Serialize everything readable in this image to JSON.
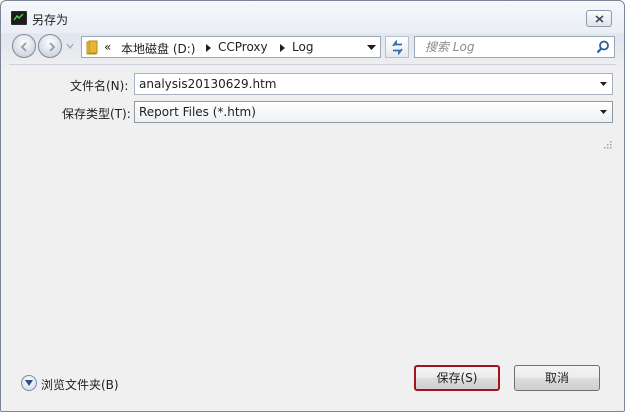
{
  "window": {
    "title": "另存为"
  },
  "address": {
    "overflow": "«",
    "crumbs": [
      "本地磁盘 (D:)",
      "CCProxy",
      "Log"
    ]
  },
  "search": {
    "placeholder": "搜索 Log"
  },
  "form": {
    "filename_label": "文件名(N):",
    "filename_value": "analysis20130629.htm",
    "filetype_label": "保存类型(T):",
    "filetype_value": "Report Files (*.htm)"
  },
  "footer": {
    "browse_label": "浏览文件夹(B)",
    "save_label": "保存(S)",
    "cancel_label": "取消"
  },
  "colors": {
    "save_border": "#a3131c",
    "window_border": "#7a8696",
    "folder": "#e8b632"
  },
  "icons": {
    "app": "terminal-icon",
    "close": "close-icon",
    "back": "back-arrow-icon",
    "forward": "forward-arrow-icon",
    "folder": "folder-icon",
    "refresh": "refresh-icon",
    "search": "search-icon"
  }
}
